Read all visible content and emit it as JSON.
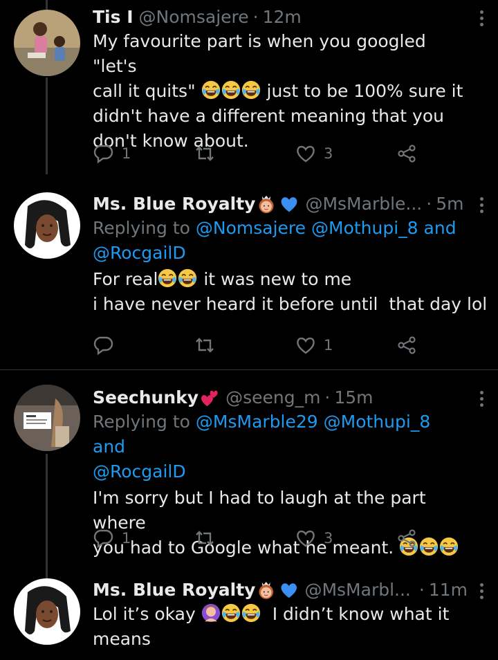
{
  "tweets": [
    {
      "name": "Tis I",
      "handle": "@Nomsajere",
      "time": "12m",
      "lines": [
        "My favourite part is when you googled \"let's",
        "just to be 100% sure it",
        "didn't have a different meaning that you",
        "don't know about."
      ],
      "line2_prefix": "call it quits\"",
      "reply_count": "1",
      "retweet_count": "",
      "like_count": "3"
    },
    {
      "name": "Ms. Blue Royalty",
      "handle": "@MsMarble...",
      "time": "5m",
      "replying_prefix": "Replying to",
      "replying_mentions": [
        "@Nomsajere",
        "@Mothupi_8",
        "and",
        "@RocgailD"
      ],
      "line1_prefix": "For real",
      "line1_suffix": "it was new to me",
      "line2": "i have never heard it before until  that day lol",
      "reply_count": "",
      "retweet_count": "",
      "like_count": "1"
    },
    {
      "name": "Seechunky",
      "handle": "@seeng_m",
      "time": "15m",
      "replying_prefix": "Replying to",
      "replying_mentions": [
        "@MsMarble29",
        "@Mothupi_8",
        "and",
        "@RocgailD"
      ],
      "line1": "I'm sorry but I had to laugh at the part where",
      "line2": "you had to Google what he meant.",
      "reply_count": "1",
      "retweet_count": "",
      "like_count": "3"
    },
    {
      "name": "Ms. Blue Royalty",
      "handle": "@MsMarbl...",
      "time": "11m",
      "line1_prefix": "Lol it’s okay",
      "line1_suffix": "I didn’t know what it",
      "line2": "means"
    }
  ],
  "icons": {
    "reply": "reply-icon",
    "retweet": "retweet-icon",
    "like": "heart-icon",
    "share": "share-icon",
    "verified": "blue-heart-emoji",
    "crown": "princess-emoji",
    "laugh": "face-with-tears-of-joy-emoji",
    "hearts": "two-hearts-emoji"
  },
  "colors": {
    "background": "#000000",
    "text": "#e7e9ea",
    "secondary": "#71767b",
    "accent": "#1d9bf0",
    "divider": "#2f3336"
  }
}
